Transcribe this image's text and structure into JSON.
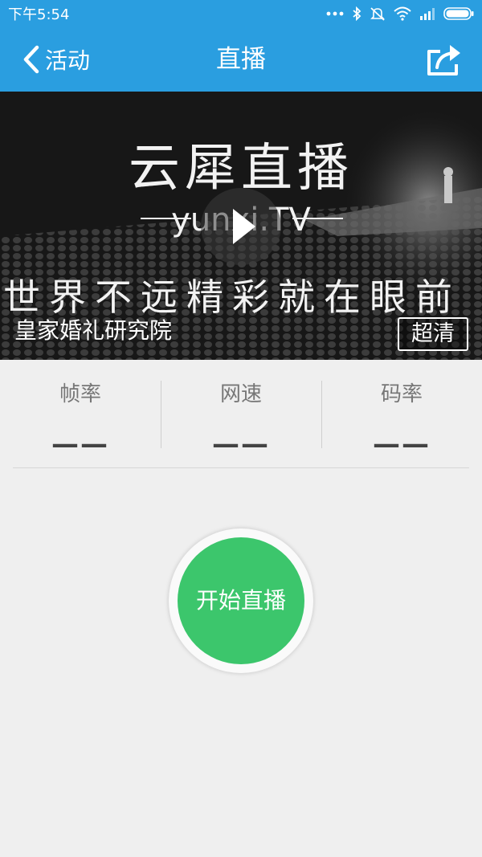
{
  "status_bar": {
    "time": "下午5:54",
    "icons": [
      "more-dots-icon",
      "bluetooth-icon",
      "mute-icon",
      "wifi-icon",
      "signal-icon",
      "battery-icon"
    ]
  },
  "nav": {
    "back_label": "活动",
    "title": "直播",
    "share_icon": "share-icon",
    "accent_color": "#2a9ee0"
  },
  "video": {
    "banner_title": "云犀直播",
    "banner_brand": "yunxi.TV",
    "banner_slogan": "世界不远精彩就在眼前",
    "caption": "皇家婚礼研究院",
    "quality_label": "超清"
  },
  "stats": [
    {
      "label": "帧率",
      "value": "——"
    },
    {
      "label": "网速",
      "value": "——"
    },
    {
      "label": "码率",
      "value": "——"
    }
  ],
  "start_button": {
    "label": "开始直播",
    "color": "#3cc66c"
  }
}
